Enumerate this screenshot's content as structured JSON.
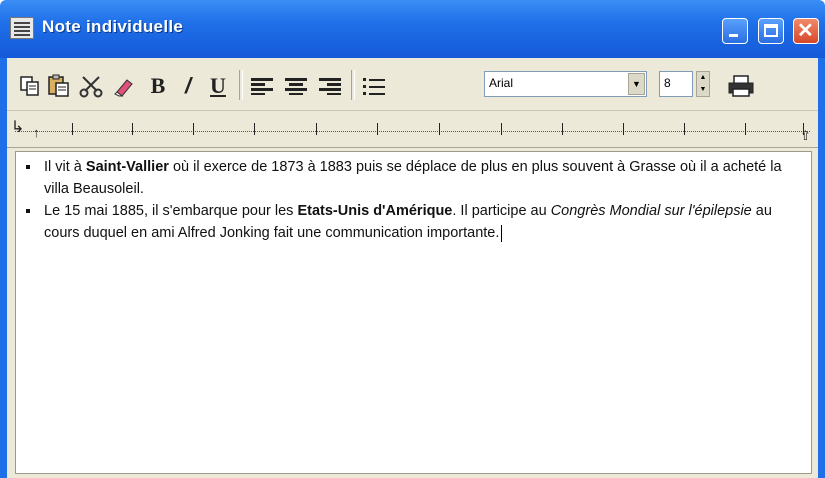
{
  "window": {
    "title": "Note individuelle"
  },
  "toolbar": {
    "buttons": [
      {
        "name": "copy-icon"
      },
      {
        "name": "paste-icon"
      },
      {
        "name": "cut-icon"
      },
      {
        "name": "eraser-icon"
      },
      {
        "name": "bold-icon",
        "label": "B"
      },
      {
        "name": "italic-icon",
        "label": "/"
      },
      {
        "name": "underline-icon",
        "label": "U"
      },
      {
        "name": "align-left-icon"
      },
      {
        "name": "align-center-icon"
      },
      {
        "name": "align-right-icon"
      },
      {
        "name": "bullet-list-icon"
      },
      {
        "name": "print-icon"
      }
    ],
    "font": "Arial",
    "size": "8"
  },
  "content": {
    "items": [
      {
        "segments": [
          {
            "text": "Il vit  à ",
            "style": "normal"
          },
          {
            "text": "Saint-Vallier",
            "style": "bold"
          },
          {
            "text": " où il exerce  de 1873 à 1883 puis se déplace de plus en plus  souvent à Grasse où il a acheté la villa Beausoleil.",
            "style": "normal"
          }
        ]
      },
      {
        "segments": [
          {
            "text": "Le 15 mai 1885, il s'embarque pour les ",
            "style": "normal"
          },
          {
            "text": "Etats-Unis d'Amérique",
            "style": "bold"
          },
          {
            "text": ". Il participe au ",
            "style": "normal"
          },
          {
            "text": "Congrès Mondial sur l'épilepsie",
            "style": "italic"
          },
          {
            "text": " au cours duquel en ami Alfred Jonking fait une communication importante.",
            "style": "normal"
          }
        ]
      }
    ]
  }
}
